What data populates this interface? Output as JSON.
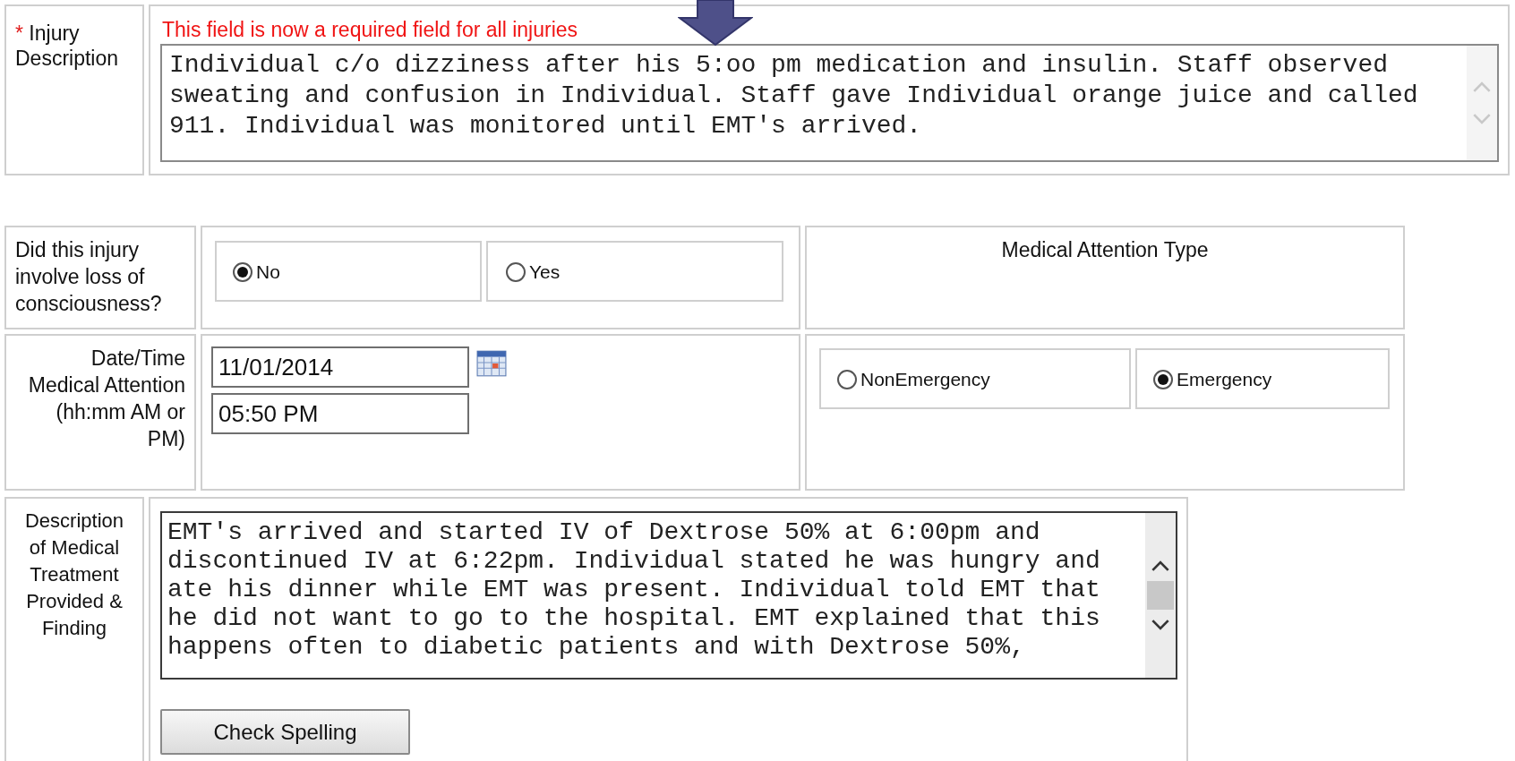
{
  "injury_description": {
    "required_mark": "*",
    "label": "Injury Description",
    "note": "This field is now a required field for all injuries",
    "lines": [
      "Individual c/o dizziness after his 5:oo pm medication and insulin. Staff observed",
      "sweating and confusion in Individual. Staff gave Individual orange juice and called",
      "911. Individual was monitored until EMT's arrived."
    ]
  },
  "loss_of_consciousness": {
    "question": "Did this injury involve loss of consciousness?",
    "options": [
      {
        "label": "No",
        "selected": true
      },
      {
        "label": "Yes",
        "selected": false
      }
    ]
  },
  "medical_attention_type": {
    "heading": "Medical Attention Type",
    "options": [
      {
        "label": "NonEmergency",
        "selected": false
      },
      {
        "label": "Emergency",
        "selected": true
      }
    ]
  },
  "date_time": {
    "label": "Date/Time Medical Attention (hh:mm AM or PM)",
    "date": "11/01/2014",
    "time": "05:50 PM"
  },
  "treatment": {
    "label": "Description of Medical Treatment Provided & Finding",
    "lines": [
      "EMT's arrived and started IV of Dextrose 50% at 6:00pm and",
      "discontinued IV at 6:22pm. Individual stated he was hungry and",
      "ate his dinner while EMT was present. Individual told EMT that",
      "he did not want to go to the hospital. EMT explained that this",
      "happens often to diabetic patients and with Dextrose 50%,"
    ],
    "button": "Check Spelling"
  }
}
